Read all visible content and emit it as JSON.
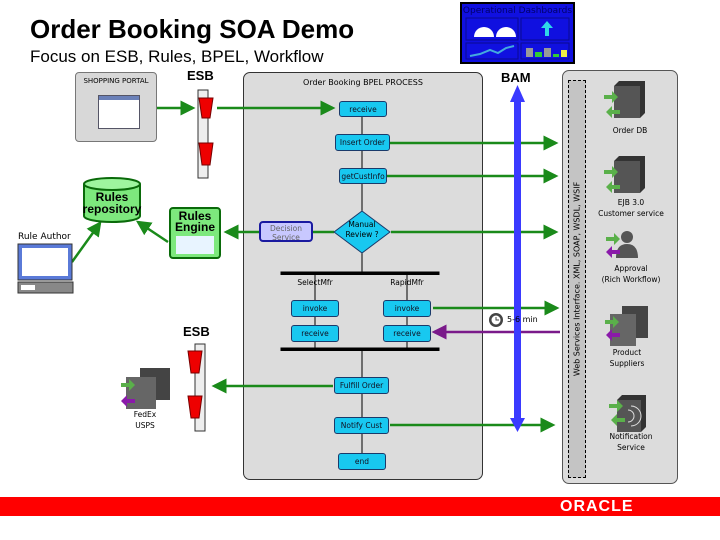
{
  "header": {
    "title": "Order Booking SOA Demo",
    "subtitle": "Focus on ESB, Rules, BPEL, Workflow"
  },
  "dashboard": {
    "label": "Operational Dashboards"
  },
  "left": {
    "portal": "SHOPPING PORTAL",
    "esb_top": "ESB",
    "esb_bottom": "ESB",
    "rules_repository": "Rules repository",
    "rules_engine": "Rules Engine",
    "rule_author": "Rule Author",
    "fedex": [
      "FedEx",
      "USPS"
    ]
  },
  "bpel": {
    "title": "Order Booking BPEL PROCESS",
    "steps": {
      "receive": "receive",
      "insert": "Insert Order",
      "getcust": "getCustInfo",
      "decision": "Decision Service",
      "manual": "Manual Review ?",
      "select": "SelectMfr",
      "rapid": "RapidMfr",
      "invoke": "invoke",
      "receive2": "receive",
      "fulfill": "Fulfill Order",
      "notify": "Notify Cust",
      "end": "end"
    }
  },
  "bam": {
    "label": "BAM",
    "timer": "5-6 min"
  },
  "services": {
    "interface": "Web Services Interface. XML, SOAP, WSDL, WSIF",
    "order_db": "Order DB",
    "ejb": [
      "EJB 3.0",
      "Customer service"
    ],
    "approval": [
      "Approval",
      "(Rich Workflow)"
    ],
    "suppliers": [
      "Product",
      "Suppliers"
    ],
    "notification": [
      "Notification",
      "Service"
    ]
  },
  "footer": {
    "logo": "ORACLE"
  },
  "colors": {
    "flow": "#1a8a1a",
    "callback": "#7a1a8a",
    "bam": "#3a3aff",
    "activity": "#18c8f0",
    "footer": "#ff0000"
  }
}
